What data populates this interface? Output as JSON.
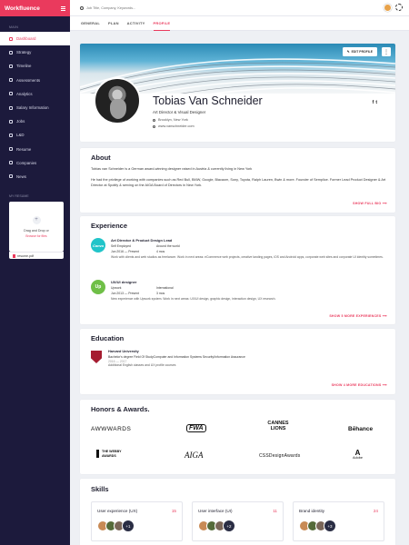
{
  "brand": {
    "name": "Workfluence"
  },
  "sidebar": {
    "section": "MAIN",
    "items": [
      {
        "label": "Dashboard"
      },
      {
        "label": "Strategy"
      },
      {
        "label": "Timeline"
      },
      {
        "label": "Assessments"
      },
      {
        "label": "Analytics"
      },
      {
        "label": "Salary Information"
      },
      {
        "label": "Jobs"
      },
      {
        "label": "L&D"
      },
      {
        "label": "Resume"
      },
      {
        "label": "Companies"
      },
      {
        "label": "News"
      }
    ],
    "reviews_label": "MY RESUME",
    "upload": {
      "title": "Drag and Drop or",
      "link": "Browse for files"
    },
    "resume_file": "resume.pdf"
  },
  "topbar": {
    "search_placeholder": "Job Title, Company, Keywords..."
  },
  "tabs": [
    {
      "label": "GENERAL"
    },
    {
      "label": "PLAN"
    },
    {
      "label": "ACTIVITY"
    },
    {
      "label": "PROFILE"
    }
  ],
  "profile": {
    "edit_label": "EDIT PROFILE",
    "name": "Tobias Van Schneider",
    "role": "Art Director & Visual Designer",
    "location": "Brooklyn, New York",
    "website": "www.vanschneider.com",
    "socials": [
      "f",
      "t"
    ]
  },
  "about": {
    "title": "About",
    "p1": "Tobias van Schneider is a German award-winning designer raised in Austria & currently living in New York",
    "p2": "He had the privilege of working with companies such as Red Bull, BMW, Google, Blacaom, Sony, Toyota, Ralph Lauren, Bwin & more. Founder of Semplice. Former Lead Product Designer & Art Director at Spotify & serving on the AIGA Board of Directors in New York.",
    "link": "SHOW FULL BIO"
  },
  "experience": {
    "title": "Experience",
    "items": [
      {
        "logo": "Canva",
        "title": "Art Director & Product Design Lead",
        "company": "Self Employed",
        "type": "Around the world",
        "dates": "Jun 2016 — Present",
        "duration": "4 mos",
        "desc": "Work with clients and web studios as freelancer. Work in next areas: eCommerce web projects, creative landing pages, iOS and Android apps, corporate web sites and corporate UI identity sometimes."
      },
      {
        "logo": "Up",
        "title": "UX/UI designer",
        "company": "Upwork",
        "type": "International",
        "dates": "Jun 2013 — Present",
        "duration": "3 mos",
        "desc": "New experience with Upwork system. Work in next areas: UX/UI design, graphic design, interaction design, UX research."
      }
    ],
    "link": "SHOW 5 MORE EXPERIENCES"
  },
  "education": {
    "title": "Education",
    "school": "Harvard University",
    "degree": "Bachelor's degree Field Of StudyComputer and Information Systems Security/Information Assurance",
    "years": "2016 — 2017",
    "note": "Additional English classes and UX profile courses",
    "link": "SHOW 4 MORE EDUCATIONS"
  },
  "honors": {
    "title": "Honors & Awards.",
    "logos": [
      "AWWWARDS",
      "FWA",
      "CANNES LIONS",
      "Bēhance",
      "THE WEBBY AWARDS",
      "AIGA",
      "CSSDesignAwards",
      "Adobe"
    ]
  },
  "skills": {
    "title": "Skills",
    "items": [
      {
        "name": "User experience (UX)",
        "count": "15",
        "more": "+1"
      },
      {
        "name": "User interface (UI)",
        "count": "11",
        "more": "+2"
      },
      {
        "name": "Brand identity",
        "count": "24",
        "more": "+3"
      }
    ]
  },
  "colors": {
    "accent": "#ea3a5d",
    "sidebar": "#1c1a3c",
    "canva": "#21c4c9",
    "upwork": "#6fbf47",
    "harvard": "#a51c30"
  }
}
